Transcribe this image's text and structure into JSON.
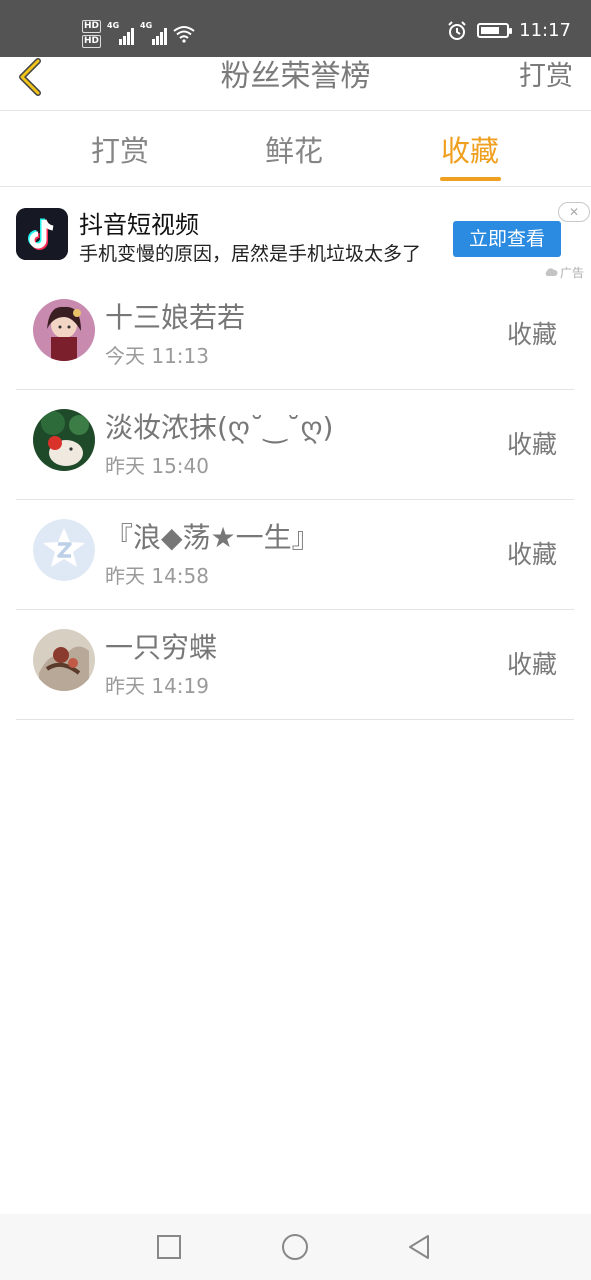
{
  "status_bar": {
    "hd_labels": [
      "HD",
      "HD"
    ],
    "signal_labels": [
      "4G",
      "4G"
    ],
    "time": "11:17",
    "battery_level": 0.75,
    "icons": [
      "wifi-icon",
      "alarm-icon",
      "battery-icon"
    ]
  },
  "navbar": {
    "title": "粉丝荣誉榜",
    "right_label": "打赏",
    "back_icon": "chevron-left-icon",
    "accent_color": "#f0a020"
  },
  "tabs": {
    "items": [
      {
        "label": "打赏"
      },
      {
        "label": "鲜花"
      },
      {
        "label": "收藏"
      }
    ],
    "active_index": 2
  },
  "ad": {
    "title": "抖音短视频",
    "description": "手机变慢的原因，居然是手机垃圾太多了",
    "button_label": "立即查看",
    "label": "广告",
    "close_icon": "close-icon"
  },
  "list": {
    "items": [
      {
        "name": "十三娘若若",
        "time": "今天 11:13",
        "action": "收藏"
      },
      {
        "name": "淡妆浓抹(ღ˘‿˘ღ)",
        "time": "昨天 15:40",
        "action": "收藏"
      },
      {
        "name": "『浪◆荡★一生』",
        "time": "昨天 14:58",
        "action": "收藏"
      },
      {
        "name": "一只穷蝶",
        "time": "昨天 14:19",
        "action": "收藏"
      }
    ]
  },
  "bottom_nav": {
    "icons": [
      "square-icon",
      "circle-icon",
      "triangle-back-icon"
    ]
  }
}
